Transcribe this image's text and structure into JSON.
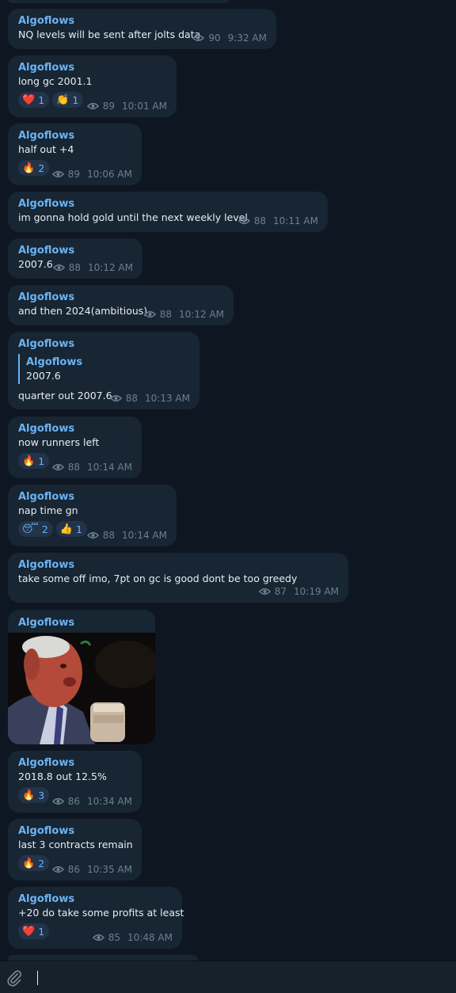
{
  "messages": [
    {
      "sender": "Algoflows",
      "text": "NQ levels will be sent after jolts data",
      "views": "90",
      "time": "9:32 AM"
    },
    {
      "sender": "Algoflows",
      "text": "long gc 2001.1",
      "views": "89",
      "time": "10:01 AM",
      "reactions": [
        {
          "emoji": "❤️",
          "count": "1"
        },
        {
          "emoji": "👏",
          "count": "1"
        }
      ]
    },
    {
      "sender": "Algoflows",
      "text": "half out +4",
      "views": "89",
      "time": "10:06 AM",
      "reactions": [
        {
          "emoji": "🔥",
          "count": "2"
        }
      ]
    },
    {
      "sender": "Algoflows",
      "text": "im gonna hold gold until the next weekly level",
      "views": "88",
      "time": "10:11 AM"
    },
    {
      "sender": "Algoflows",
      "text": "2007.6",
      "views": "88",
      "time": "10:12 AM"
    },
    {
      "sender": "Algoflows",
      "text": "and then 2024(ambitious)",
      "views": "88",
      "time": "10:12 AM"
    },
    {
      "sender": "Algoflows",
      "quote": {
        "sender": "Algoflows",
        "text": "2007.6"
      },
      "text": "quarter out 2007.6",
      "views": "88",
      "time": "10:13 AM"
    },
    {
      "sender": "Algoflows",
      "text": "now runners left",
      "views": "88",
      "time": "10:14 AM",
      "reactions": [
        {
          "emoji": "🔥",
          "count": "1"
        }
      ]
    },
    {
      "sender": "Algoflows",
      "text": "nap time gn",
      "views": "88",
      "time": "10:14 AM",
      "reactions": [
        {
          "emoji": "😴",
          "count": "2"
        },
        {
          "emoji": "👍",
          "count": "1"
        }
      ]
    },
    {
      "sender": "Algoflows",
      "text": "take some off imo, 7pt on gc is good dont be too greedy",
      "views": "87",
      "time": "10:19 AM"
    },
    {
      "sender": "Algoflows",
      "media": "photo"
    },
    {
      "sender": "Algoflows",
      "text": "2018.8 out 12.5%",
      "views": "86",
      "time": "10:34 AM",
      "reactions": [
        {
          "emoji": "🔥",
          "count": "3"
        }
      ]
    },
    {
      "sender": "Algoflows",
      "text": "last 3 contracts remain",
      "views": "86",
      "time": "10:35 AM",
      "reactions": [
        {
          "emoji": "🔥",
          "count": "2"
        }
      ]
    },
    {
      "sender": "Algoflows",
      "text": "+20 do take some profits at least",
      "views": "85",
      "time": "10:48 AM",
      "reactions": [
        {
          "emoji": "❤️",
          "count": "1"
        }
      ]
    }
  ],
  "composer": {
    "attach_icon": "paperclip-icon",
    "value": ""
  },
  "colors": {
    "background": "#0e1621",
    "bubble": "#182533",
    "sender": "#6ab3f3",
    "meta": "#6d7f8f"
  }
}
